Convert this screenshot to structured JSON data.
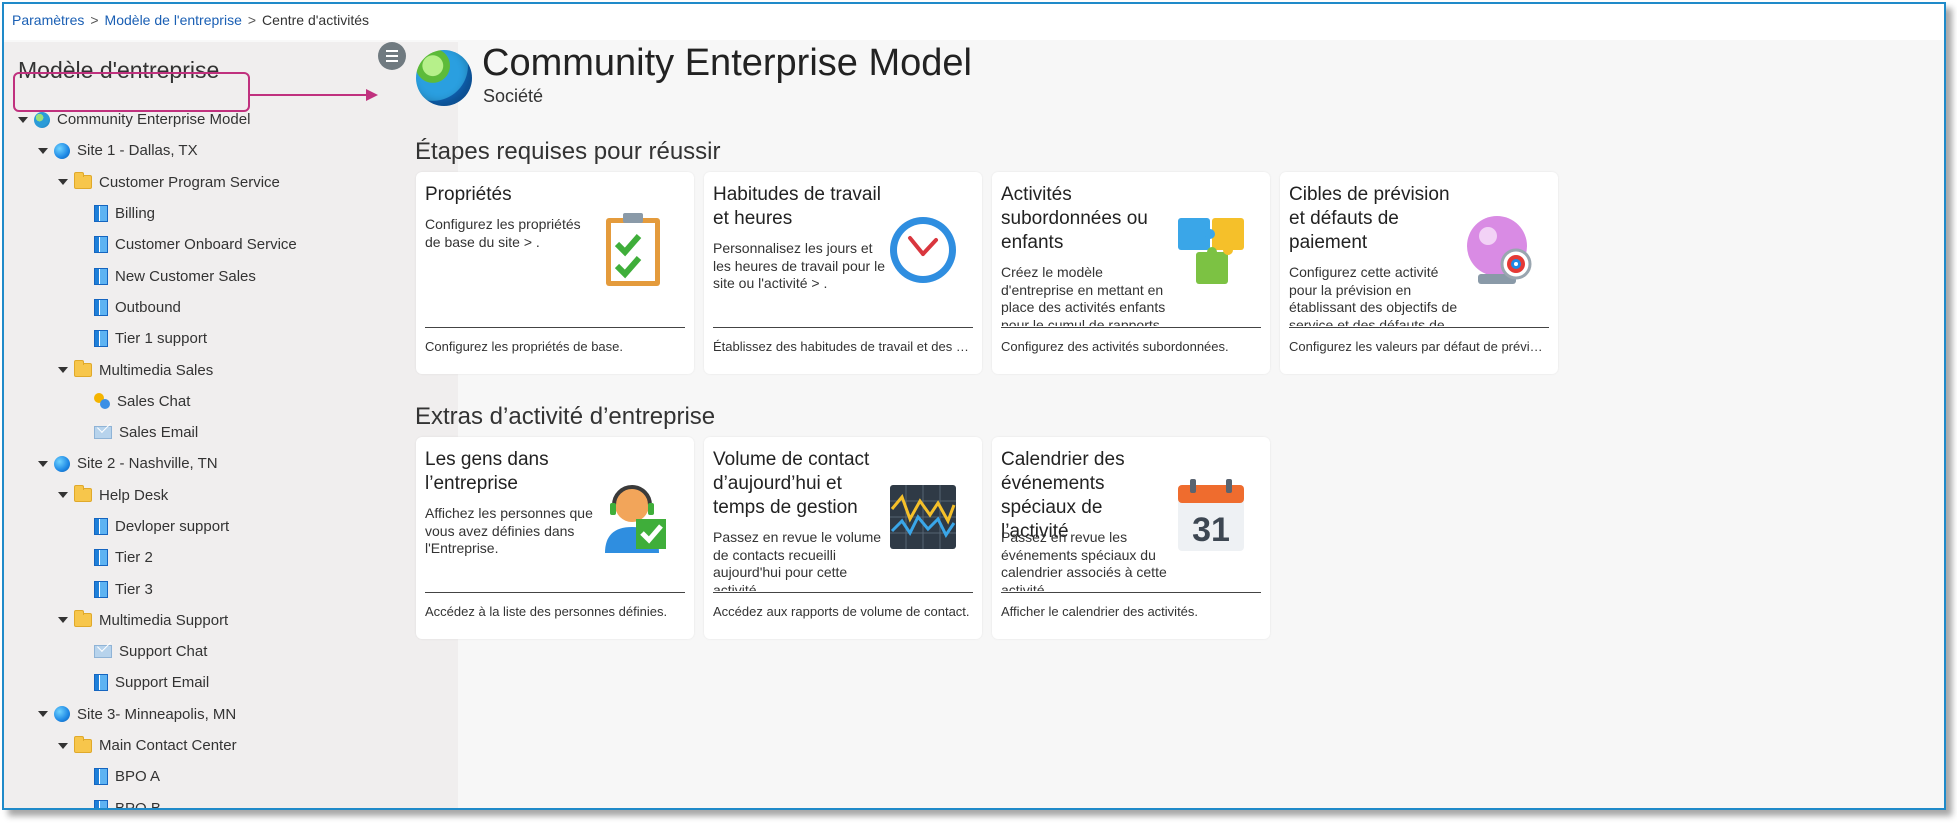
{
  "breadcrumb": {
    "item1": "Paramètres",
    "item2": "Modèle de l'entreprise",
    "item3": "Centre d'activités",
    "separator": ">"
  },
  "sidebar": {
    "title": "Modèle d'entreprise",
    "tree": [
      {
        "label": "Community Enterprise Model",
        "level": 0,
        "icon": "earth-icon",
        "expanded": true
      },
      {
        "label": "Site 1 - Dallas, TX",
        "level": 1,
        "icon": "globe-icon",
        "expanded": true
      },
      {
        "label": "Customer Program Service",
        "level": 2,
        "icon": "folder-icon",
        "expanded": true
      },
      {
        "label": "Billing",
        "level": 3,
        "icon": "queue-icon"
      },
      {
        "label": "Customer Onboard Service",
        "level": 3,
        "icon": "queue-icon"
      },
      {
        "label": "New Customer Sales",
        "level": 3,
        "icon": "queue-icon"
      },
      {
        "label": "Outbound",
        "level": 3,
        "icon": "queue-icon"
      },
      {
        "label": "Tier 1 support",
        "level": 3,
        "icon": "queue-icon"
      },
      {
        "label": "Multimedia Sales",
        "level": 2,
        "icon": "folder-icon",
        "expanded": true
      },
      {
        "label": "Sales Chat",
        "level": 3,
        "icon": "chat-icon"
      },
      {
        "label": "Sales Email",
        "level": 3,
        "icon": "mail-icon"
      },
      {
        "label": "Site 2 - Nashville, TN",
        "level": 1,
        "icon": "globe-icon",
        "expanded": true
      },
      {
        "label": "Help Desk",
        "level": 2,
        "icon": "folder-icon",
        "expanded": true
      },
      {
        "label": "Devloper support",
        "level": 3,
        "icon": "queue-icon"
      },
      {
        "label": "Tier 2",
        "level": 3,
        "icon": "queue-icon"
      },
      {
        "label": "Tier 3",
        "level": 3,
        "icon": "queue-icon"
      },
      {
        "label": "Multimedia Support",
        "level": 2,
        "icon": "folder-icon",
        "expanded": true
      },
      {
        "label": "Support Chat",
        "level": 3,
        "icon": "mail-icon"
      },
      {
        "label": "Support Email",
        "level": 3,
        "icon": "queue-icon"
      },
      {
        "label": "Site 3- Minneapolis, MN",
        "level": 1,
        "icon": "globe-icon",
        "expanded": true
      },
      {
        "label": "Main Contact Center",
        "level": 2,
        "icon": "folder-icon",
        "expanded": true
      },
      {
        "label": "BPO A",
        "level": 3,
        "icon": "queue-icon"
      },
      {
        "label": "BPO B",
        "level": 3,
        "icon": "queue-icon"
      }
    ]
  },
  "hero": {
    "title": "Community Enterprise Model",
    "subtitle": "Société"
  },
  "sections": {
    "required": "Étapes requises pour réussir",
    "extras": "Extras d’activité d’entreprise"
  },
  "cards": {
    "properties": {
      "title": "Propriétés",
      "desc": "Configurez les propriétés de base du site > .",
      "link": "Configurez les propriétés de base."
    },
    "hours": {
      "title": "Habitudes de travail et heures",
      "desc": "Personnalisez les jours et les heures de travail pour le site ou l'activité > .",
      "link": "Établissez des habitudes de travail et des heure..."
    },
    "children": {
      "title": "Activités subordonnées ou enfants",
      "desc": "Créez le modèle d'entreprise en mettant en place des activités enfants pour le cumul de rapports",
      "link": "Configurez des activités subordonnées."
    },
    "forecast": {
      "title": "Cibles de prévision et défauts de paiement",
      "desc": "Configurez cette activité pour la prévision en établissant des objectifs de service et des défauts de",
      "link": "Configurez les valeurs par défaut de prévision."
    },
    "people": {
      "title": "Les gens dans l’entreprise",
      "desc": "Affichez les personnes que vous avez définies dans l'Entreprise.",
      "link": "Accédez à la liste des personnes définies."
    },
    "volume": {
      "title": "Volume de contact d’aujourd’hui et temps de gestion",
      "desc": "Passez en revue le volume de contacts recueilli aujourd'hui pour cette activité",
      "link": "Accédez aux rapports de volume de contact."
    },
    "calendar": {
      "title": "Calendrier des événements spéciaux de l’activité",
      "desc": "Passez en revue les événements spéciaux du calendrier associés à cette activité",
      "link": "Afficher le calendrier des activités.",
      "day": "31"
    }
  },
  "colors": {
    "highlight": "#c0317e",
    "link": "#1a5fb4",
    "frame": "#1f8ac9"
  }
}
